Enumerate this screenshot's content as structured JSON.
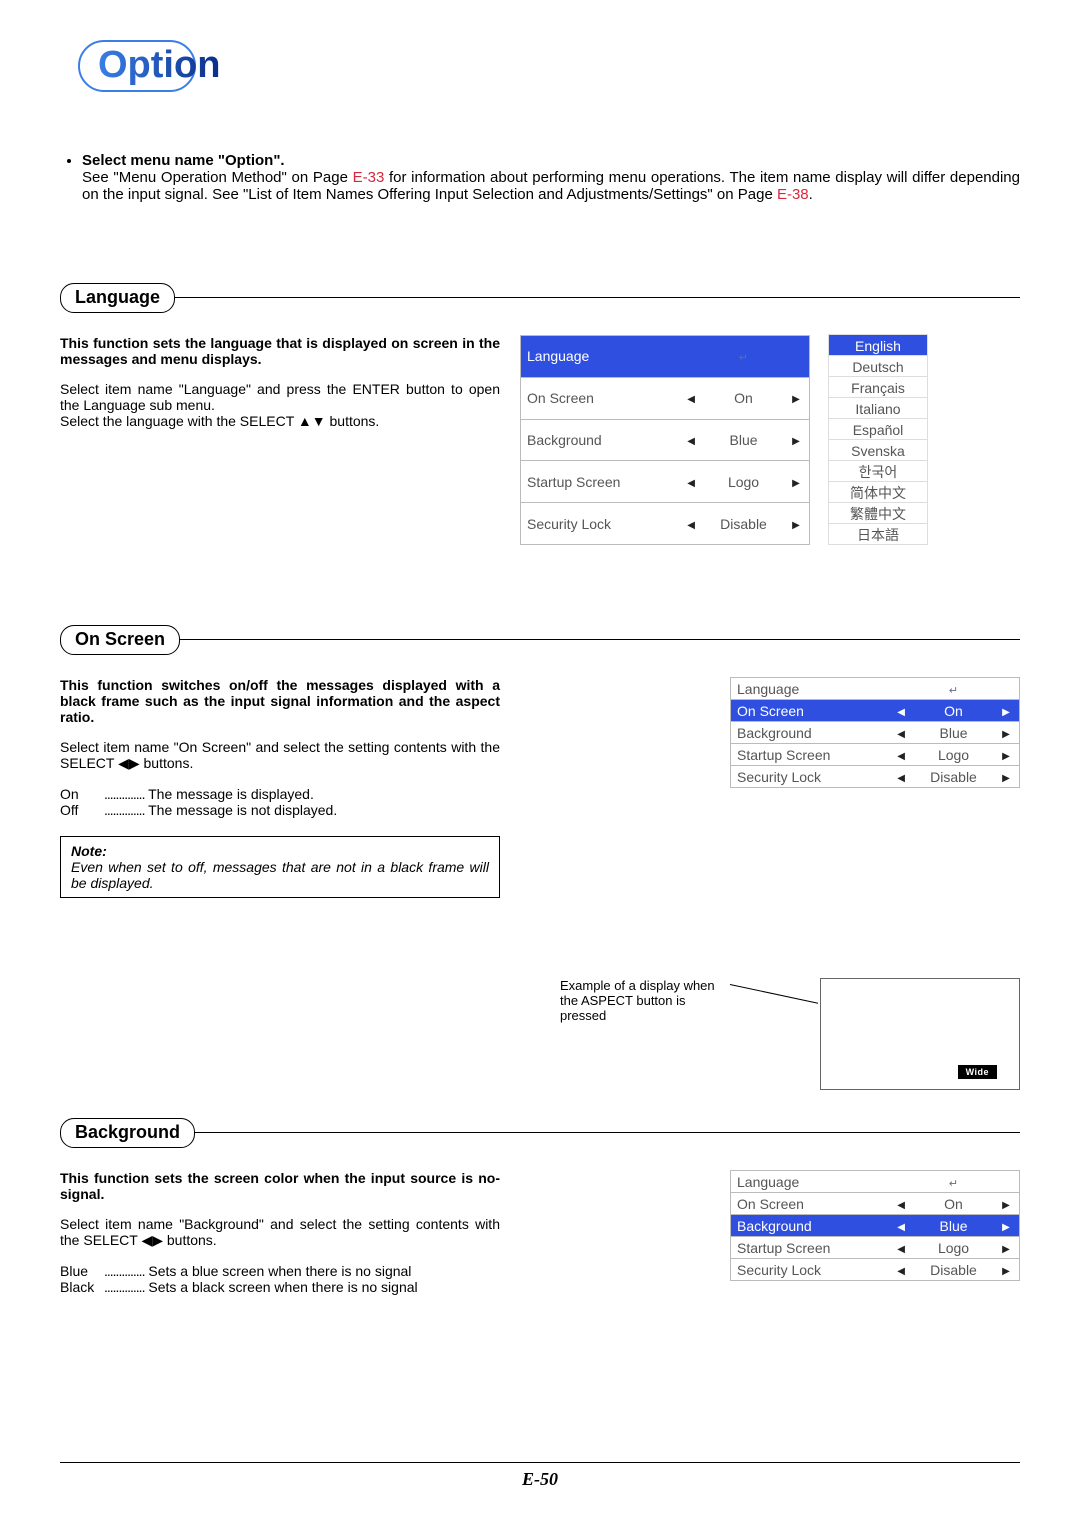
{
  "page_title": "Option",
  "page_number": "E-50",
  "intro": {
    "heading": "Select menu name \"Option\".",
    "body_a": "See \"Menu Operation Method\" on Page ",
    "ref1": "E-33",
    "body_b": " for information about performing menu operations. The item name display will differ depending on the input signal. See \"List of Item Names Offering Input Selection and Adjustments/Settings\" on Page ",
    "ref2": "E-38",
    "body_c": "."
  },
  "section_language": {
    "title": "Language",
    "bold": "This function sets the language that is displayed on screen in the messages and menu displays.",
    "para1": "Select item name \"Language\" and press the ENTER button to open the Language sub menu.",
    "para2": "Select the language with the SELECT ▲▼ buttons."
  },
  "section_onscreen": {
    "title": "On Screen",
    "bold": "This function switches on/off the messages displayed with a black frame such as the input signal information and the aspect ratio.",
    "para1": "Select item name \"On Screen\" and select the setting contents with the SELECT ◀▶ buttons.",
    "opt_on_label": "On",
    "opt_on_desc": "The message is displayed.",
    "opt_off_label": "Off",
    "opt_off_desc": "The message is not displayed.",
    "note_label": "Note:",
    "note_text": "Even when set to off, messages that are not in a black frame will be displayed."
  },
  "aspect_example": {
    "caption": "Example of a display when the ASPECT button is pressed",
    "badge": "Wide"
  },
  "section_background": {
    "title": "Background",
    "bold": "This function sets the screen color when the input source is no-signal.",
    "para1": "Select item name \"Background\" and select the setting contents with the SELECT ◀▶ buttons.",
    "opt_blue_label": "Blue",
    "opt_blue_desc": "Sets a blue screen when there is no signal",
    "opt_black_label": "Black",
    "opt_black_desc": "Sets a black screen when there is no signal"
  },
  "menu_labels": {
    "language": "Language",
    "onscreen": "On Screen",
    "background": "Background",
    "startup": "Startup Screen",
    "security": "Security Lock"
  },
  "menu_values": {
    "on": "On",
    "blue": "Blue",
    "logo": "Logo",
    "disable": "Disable"
  },
  "languages": [
    "English",
    "Deutsch",
    "Français",
    "Italiano",
    "Español",
    "Svenska",
    "한국어",
    "简体中文",
    "繁體中文",
    "日本語"
  ]
}
